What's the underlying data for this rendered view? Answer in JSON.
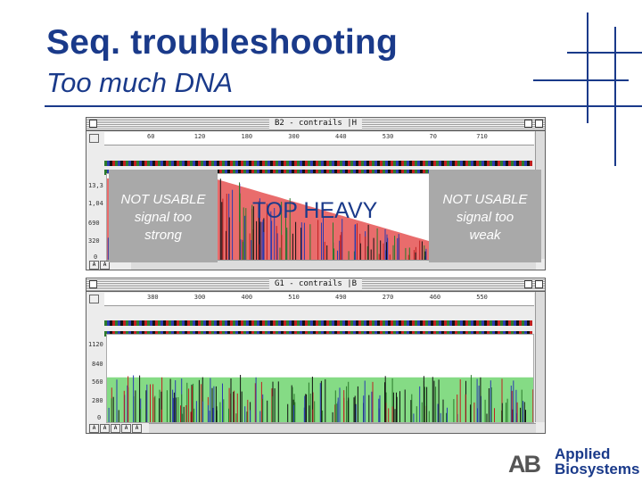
{
  "slide": {
    "title": "Seq. troubleshooting",
    "subtitle": "Too much DNA",
    "accent_color": "#1a3a8a"
  },
  "window_top": {
    "title": "B2 - contrails |H",
    "ruler_ticks": [
      "60",
      "120",
      "180",
      "300",
      "440",
      "530",
      "70",
      "710"
    ],
    "y_axis": [
      "13,3",
      "1,04",
      "690",
      "320",
      "0"
    ],
    "trace_color": "#e23b3b",
    "trace_shape": "decaying"
  },
  "window_bottom": {
    "title": "G1 - contrails |B",
    "ruler_ticks": [
      "380",
      "300",
      "400",
      "510",
      "490",
      "270",
      "460",
      "550"
    ],
    "y_axis": [
      "1120",
      "840",
      "560",
      "280",
      "0"
    ],
    "trace_color": "#5ccf5c",
    "trace_shape": "flat"
  },
  "overlays": {
    "left": {
      "lines": [
        "NOT USABLE",
        "signal too",
        "strong"
      ]
    },
    "center": {
      "label": "TOP HEAVY"
    },
    "right": {
      "lines": [
        "NOT USABLE",
        "signal too",
        "weak"
      ]
    }
  },
  "logo": {
    "mark": "AB",
    "line1": "Applied",
    "line2": "Biosystems"
  }
}
